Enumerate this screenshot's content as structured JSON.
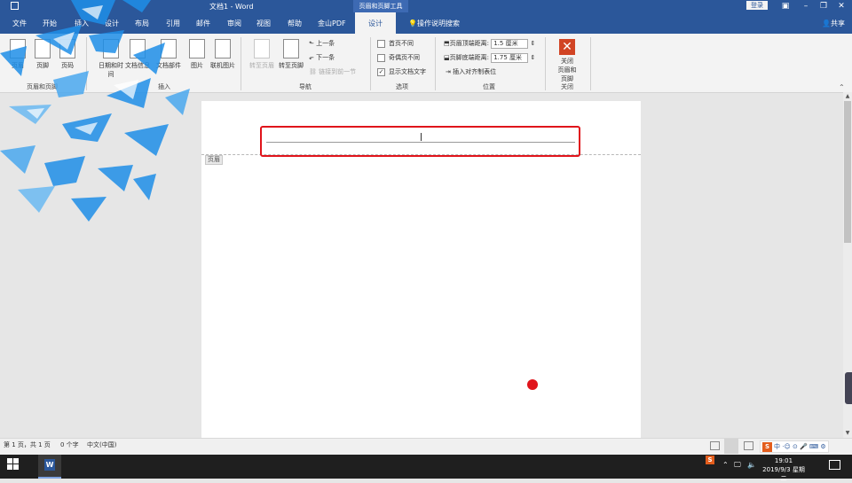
{
  "titlebar": {
    "doc_title": "文档1 - Word",
    "context_tab": "页眉和页脚工具",
    "login": "登录",
    "ctrl_icons": [
      "ribbon-display-icon",
      "minimize-icon",
      "restore-icon",
      "close-icon"
    ]
  },
  "tabs": [
    {
      "label": "文件",
      "active": false
    },
    {
      "label": "开始",
      "active": false
    },
    {
      "label": "插入",
      "active": false
    },
    {
      "label": "设计",
      "active": false
    },
    {
      "label": "布局",
      "active": false
    },
    {
      "label": "引用",
      "active": false
    },
    {
      "label": "邮件",
      "active": false
    },
    {
      "label": "审阅",
      "active": false
    },
    {
      "label": "视图",
      "active": false
    },
    {
      "label": "帮助",
      "active": false
    },
    {
      "label": "金山PDF",
      "active": false
    },
    {
      "label": "设计",
      "active": true
    }
  ],
  "tell_me": "操作说明搜索",
  "share": "共享",
  "ribbon": {
    "header_footer_group": {
      "label": "页眉和页脚",
      "buttons": [
        "页眉",
        "页脚",
        "页码"
      ]
    },
    "insert_group": {
      "label": "插入",
      "buttons": [
        "日期和时间",
        "文档信息",
        "文档部件",
        "图片",
        "联机图片"
      ]
    },
    "navigation_group": {
      "label": "导航",
      "goto_header": "转至页眉",
      "goto_footer": "转至页脚",
      "previous": "上一条",
      "next": "下一条",
      "link_previous": "链接到前一节"
    },
    "options_group": {
      "label": "选项",
      "first_page": "首页不同",
      "odd_even": "奇偶页不同",
      "show_doc_text": "显示文档文字",
      "show_doc_text_checked": "✓"
    },
    "position_group": {
      "label": "位置",
      "header_top_label": "页眉顶端距离:",
      "header_top_value": "1.5 厘米",
      "footer_bottom_label": "页脚底端距离:",
      "footer_bottom_value": "1.75 厘米",
      "insert_align_tab": "插入对齐制表位"
    },
    "close_group": {
      "label": "关闭",
      "close_button_line1": "关闭",
      "close_button_line2": "页眉和页脚"
    }
  },
  "document": {
    "header_tag": "页眉"
  },
  "statusbar": {
    "page_info": "第 1 页，共 1 页",
    "word_count": "0 个字",
    "language": "中文(中国)",
    "ime_label": "中"
  },
  "taskbar": {
    "time": "19:01",
    "date": "2019/9/3 星期二"
  },
  "colors": {
    "word_blue": "#2b579a",
    "highlight_red": "#e0141b",
    "close_orange": "#d14424"
  }
}
